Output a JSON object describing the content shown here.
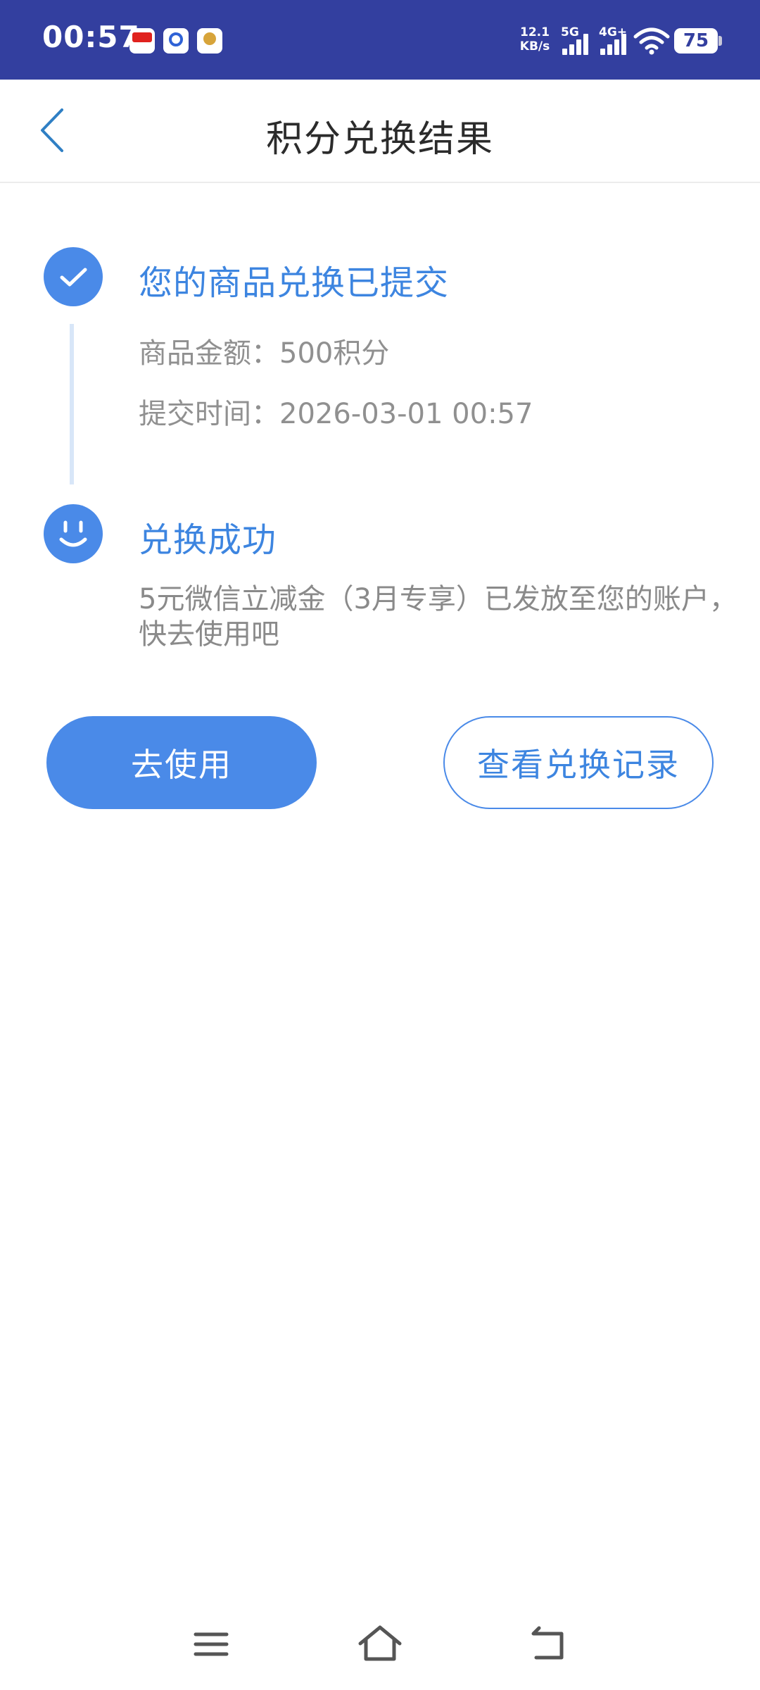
{
  "status_bar": {
    "time": "00:57",
    "net_speed_value": "12.1",
    "net_speed_unit": "KB/s",
    "signal_1_label": "5G",
    "signal_2_label": "4G+",
    "battery_level": "75"
  },
  "header": {
    "title": "积分兑换结果"
  },
  "steps": [
    {
      "title": "您的商品兑换已提交",
      "amount_line": "商品金额：500积分",
      "time_line": "提交时间：2026-03-01 00:57"
    },
    {
      "title": "兑换成功",
      "description": "5元微信立减金（3月专享）已发放至您的账户，快去使用吧"
    }
  ],
  "buttons": {
    "use_label": "去使用",
    "records_label": "查看兑换记录"
  },
  "colors": {
    "status_bar_bg": "#333f9f",
    "accent": "#4a8ae8",
    "accent_text": "#3d85e0",
    "muted_text": "#909090"
  },
  "icons": {
    "back": "chevron-left-icon",
    "step_1": "check-icon",
    "step_2": "smile-icon",
    "nav_menu": "menu-icon",
    "nav_home": "home-icon",
    "nav_back": "back-arrow-icon"
  }
}
